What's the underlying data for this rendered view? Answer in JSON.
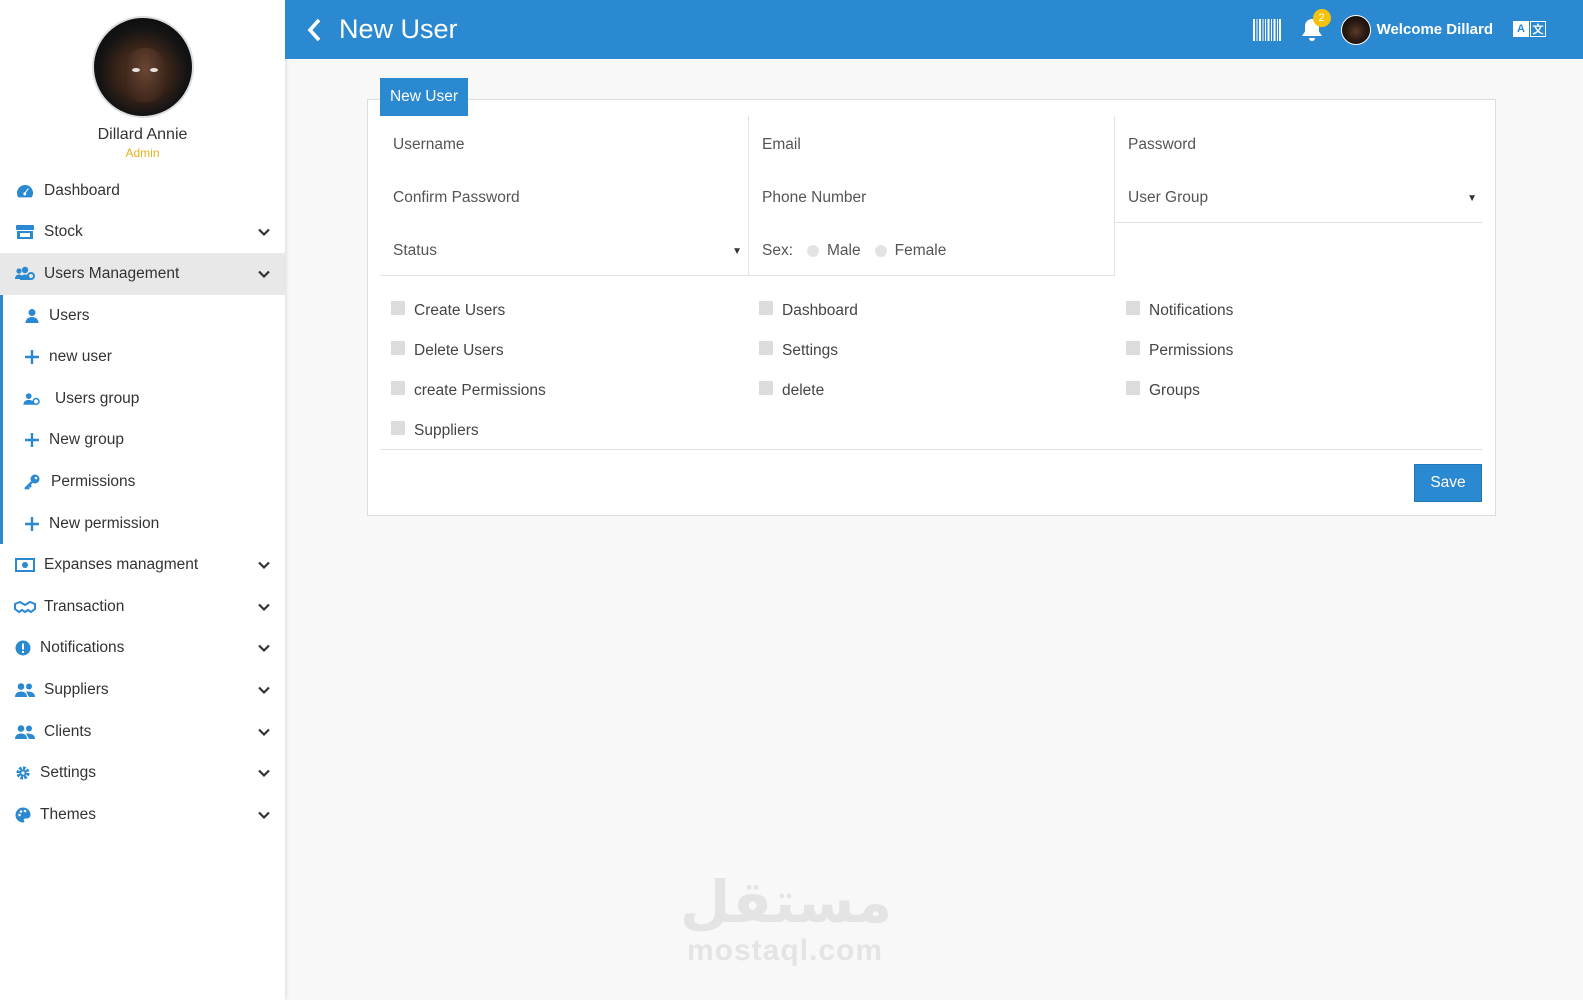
{
  "profile": {
    "name": "Dillard Annie",
    "role": "Admin"
  },
  "sidebar": {
    "items": [
      {
        "label": "Dashboard",
        "icon": "dashboard-icon",
        "chevron": false
      },
      {
        "label": "Stock",
        "icon": "store-icon",
        "chevron": true
      },
      {
        "label": "Users Management",
        "icon": "users-cog-icon",
        "chevron": true,
        "active": true
      }
    ],
    "submenu": [
      {
        "label": "Users",
        "icon": "user-icon"
      },
      {
        "label": "new user",
        "icon": "plus-icon"
      },
      {
        "label": "Users group",
        "icon": "users-group-icon"
      },
      {
        "label": "New group",
        "icon": "plus-icon"
      },
      {
        "label": "Permissions",
        "icon": "key-icon"
      },
      {
        "label": "New permission",
        "icon": "plus-icon"
      }
    ],
    "items_after": [
      {
        "label": "Expanses managment",
        "icon": "money-bill-icon"
      },
      {
        "label": "Transaction",
        "icon": "handshake-icon"
      },
      {
        "label": "Notifications",
        "icon": "exclamation-circle-icon"
      },
      {
        "label": "Suppliers",
        "icon": "users-icon"
      },
      {
        "label": "Clients",
        "icon": "users-icon"
      },
      {
        "label": "Settings",
        "icon": "gear-icon"
      },
      {
        "label": "Themes",
        "icon": "palette-icon"
      }
    ]
  },
  "header": {
    "title": "New User",
    "notification_count": "2",
    "welcome": "Welcome Dillard",
    "lang_a": "A",
    "lang_b": "文"
  },
  "form": {
    "tab_label": "New User",
    "username_placeholder": "Username",
    "email_placeholder": "Email",
    "password_placeholder": "Password",
    "confirm_password_placeholder": "Confirm Password",
    "phone_placeholder": "Phone Number",
    "user_group_selected": "User Group",
    "status_selected": "Status",
    "sex_label": "Sex:",
    "sex_options": [
      "Male",
      "Female"
    ],
    "permissions": [
      [
        "Create Users",
        "Dashboard",
        "Notifications"
      ],
      [
        "Delete Users",
        "Settings",
        "Permissions"
      ],
      [
        "create Permissions",
        "delete",
        "Groups"
      ],
      [
        "Suppliers"
      ]
    ],
    "save_label": "Save"
  },
  "watermark": {
    "arabic": "مستقل",
    "latin": "mostaql.com"
  },
  "colors": {
    "primary": "#2a89d0",
    "badge": "#f4c20d",
    "role": "#e6b11a"
  }
}
